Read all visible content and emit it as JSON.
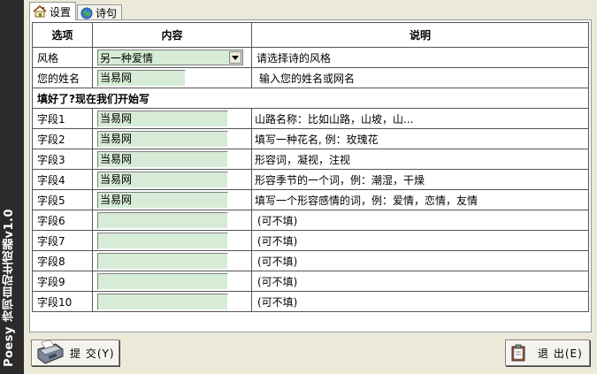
{
  "app": {
    "title": "Poesy 诗词自动生成器v1.0"
  },
  "tabs": [
    {
      "label": "设置"
    },
    {
      "label": "诗句"
    }
  ],
  "table": {
    "headers": {
      "option": "选项",
      "content": "内容",
      "desc": "说明"
    },
    "style_row": {
      "label": "风格",
      "value": "另一种爱情",
      "desc": "请选择诗的风格"
    },
    "name_row": {
      "label": "您的姓名",
      "value": "当易网",
      "desc": "输入您的姓名或网名"
    },
    "section": "填好了?现在我们开始写",
    "fields": [
      {
        "label": "字段1",
        "value": "当易网",
        "desc": "山路名称：比如山路，山坡，山..."
      },
      {
        "label": "字段2",
        "value": "当易网",
        "desc": "填写一种花名, 例：玫瑰花"
      },
      {
        "label": "字段3",
        "value": "当易网",
        "desc": "形容词，凝视，注视"
      },
      {
        "label": "字段4",
        "value": "当易网",
        "desc": "形容季节的一个词，例：潮湿，干燥"
      },
      {
        "label": "字段5",
        "value": "当易网",
        "desc": "填写一个形容感情的词，例：爱情，恋情，友情"
      },
      {
        "label": "字段6",
        "value": "",
        "desc": "(可不填)"
      },
      {
        "label": "字段7",
        "value": "",
        "desc": "(可不填)"
      },
      {
        "label": "字段8",
        "value": "",
        "desc": "(可不填)"
      },
      {
        "label": "字段9",
        "value": "",
        "desc": "(可不填)"
      },
      {
        "label": "字段10",
        "value": "",
        "desc": "(可不填)"
      }
    ]
  },
  "buttons": {
    "submit": "提 交(Y)",
    "exit": "退 出(E)"
  },
  "colors": {
    "input_bg": "#d6ecd6",
    "sidebar": "#2b2b2b",
    "window_bg": "#ece9d8"
  }
}
